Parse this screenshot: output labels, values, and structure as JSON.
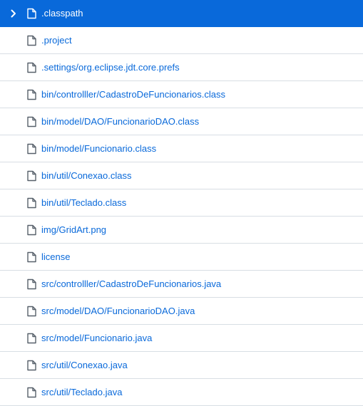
{
  "colors": {
    "selected_background": "#0969da",
    "link_text": "#0969da",
    "selected_text": "#ffffff",
    "divider": "#d8dee4",
    "icon": "#57606a"
  },
  "files": [
    {
      "name": ".classpath",
      "icon": "file-icon",
      "selected": true,
      "expand_icon": "chevron-right-icon"
    },
    {
      "name": ".project",
      "icon": "file-icon"
    },
    {
      "name": ".settings/org.eclipse.jdt.core.prefs",
      "icon": "file-icon"
    },
    {
      "name": "bin/controlller/CadastroDeFuncionarios.class",
      "icon": "file-icon"
    },
    {
      "name": "bin/model/DAO/FuncionarioDAO.class",
      "icon": "file-icon"
    },
    {
      "name": "bin/model/Funcionario.class",
      "icon": "file-icon"
    },
    {
      "name": "bin/util/Conexao.class",
      "icon": "file-icon"
    },
    {
      "name": "bin/util/Teclado.class",
      "icon": "file-icon"
    },
    {
      "name": "img/GridArt.png",
      "icon": "file-icon"
    },
    {
      "name": "license",
      "icon": "file-icon"
    },
    {
      "name": "src/controlller/CadastroDeFuncionarios.java",
      "icon": "file-icon"
    },
    {
      "name": "src/model/DAO/FuncionarioDAO.java",
      "icon": "file-icon"
    },
    {
      "name": "src/model/Funcionario.java",
      "icon": "file-icon"
    },
    {
      "name": "src/util/Conexao.java",
      "icon": "file-icon"
    },
    {
      "name": "src/util/Teclado.java",
      "icon": "file-icon"
    }
  ]
}
